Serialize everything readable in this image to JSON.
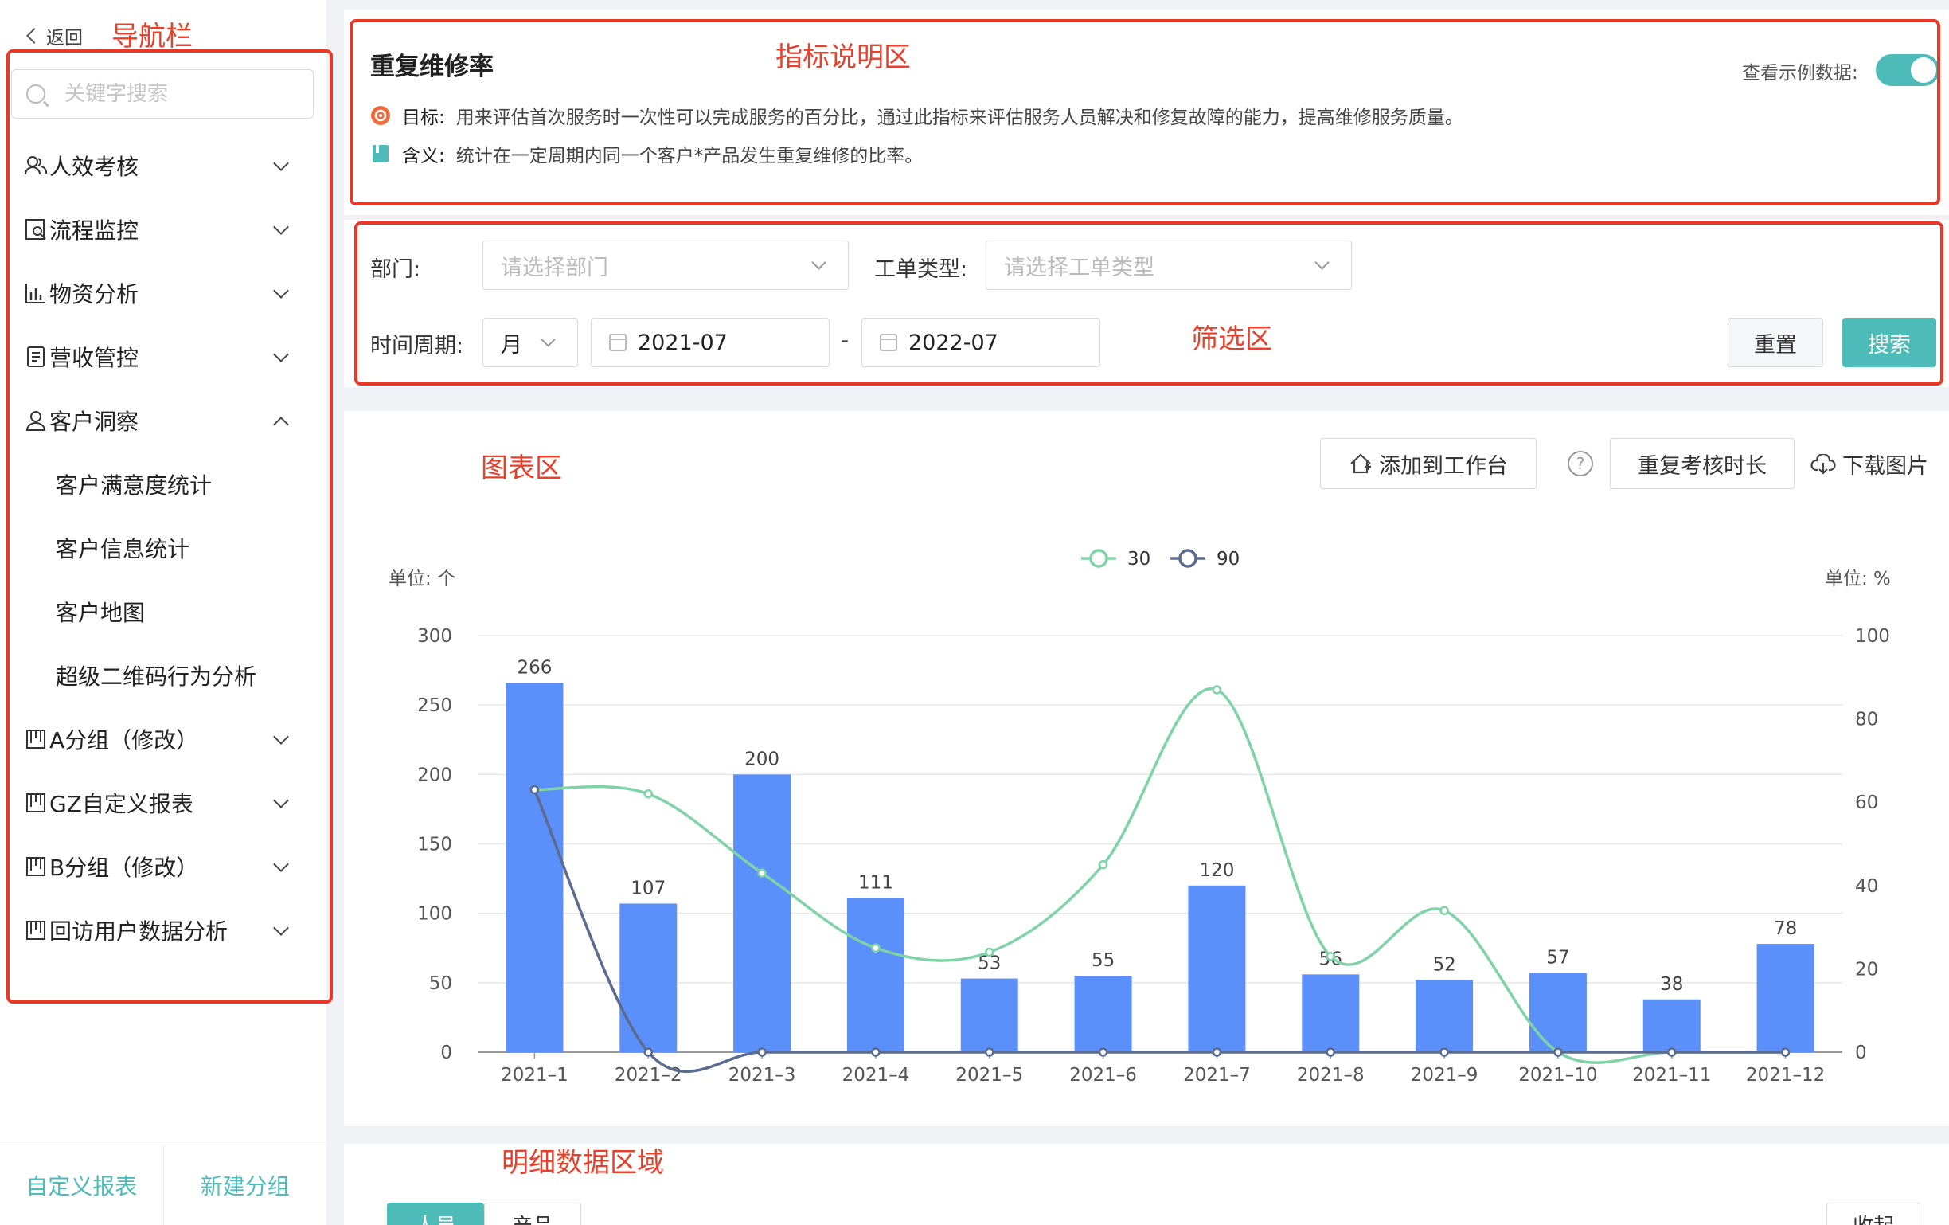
{
  "annotations": {
    "nav": "导航栏",
    "indicator": "指标说明区",
    "filter": "筛选区",
    "chart": "图表区",
    "detail": "明细数据区域"
  },
  "sidebar": {
    "back_label": "返回",
    "search_placeholder": "关键字搜索",
    "items": [
      {
        "label": "人效考核",
        "icon": "people-icon",
        "expanded": false
      },
      {
        "label": "流程监控",
        "icon": "process-icon",
        "expanded": false
      },
      {
        "label": "物资分析",
        "icon": "bar-icon",
        "expanded": false
      },
      {
        "label": "营收管控",
        "icon": "receipt-icon",
        "expanded": false
      },
      {
        "label": "客户洞察",
        "icon": "user-icon",
        "expanded": true,
        "children": [
          "客户满意度统计",
          "客户信息统计",
          "客户地图",
          "超级二维码行为分析"
        ]
      },
      {
        "label": "A分组（修改）",
        "icon": "board-icon",
        "expanded": false
      },
      {
        "label": "GZ自定义报表",
        "icon": "board-icon",
        "expanded": false
      },
      {
        "label": "B分组（修改）",
        "icon": "board-icon",
        "expanded": false
      },
      {
        "label": "回访用户数据分析",
        "icon": "board-icon",
        "expanded": false
      }
    ],
    "bottom": {
      "custom_report": "自定义报表",
      "new_group": "新建分组"
    }
  },
  "indicator": {
    "title": "重复维修率",
    "goal_label": "目标:",
    "goal_text": "用来评估首次服务时一次性可以完成服务的百分比，通过此指标来评估服务人员解决和修复故障的能力，提高维修服务质量。",
    "meaning_label": "含义:",
    "meaning_text": "统计在一定周期内同一个客户*产品发生重复维修的比率。",
    "example_label": "查看示例数据:",
    "example_on": true
  },
  "filter": {
    "dept_label": "部门:",
    "dept_placeholder": "请选择部门",
    "type_label": "工单类型:",
    "type_placeholder": "请选择工单类型",
    "period_label": "时间周期:",
    "period_value": "月",
    "start": "2021-07",
    "end": "2022-07",
    "dash": "-",
    "reset": "重置",
    "search": "搜索"
  },
  "toolbar": {
    "add_to_workbench": "添加到工作台",
    "help": "?",
    "repeat_duration": "重复考核时长",
    "download": "下载图片"
  },
  "chart_data": {
    "type": "bar",
    "categories": [
      "2021–1",
      "2021–2",
      "2021–3",
      "2021–4",
      "2021–5",
      "2021–6",
      "2021–7",
      "2021–8",
      "2021–9",
      "2021–10",
      "2021–11",
      "2021–12"
    ],
    "bar_values": [
      266,
      107,
      200,
      111,
      53,
      55,
      120,
      56,
      52,
      57,
      38,
      78
    ],
    "left_unit": "单位: 个",
    "right_unit": "单位: %",
    "left_ticks": [
      0,
      50,
      100,
      150,
      200,
      250,
      300
    ],
    "right_ticks": [
      0,
      20,
      40,
      60,
      80,
      100
    ],
    "ylim_left": [
      0,
      300
    ],
    "ylim_right": [
      0,
      100
    ],
    "series": [
      {
        "name": "30",
        "color": "#7fd3a6",
        "axis": "right",
        "values": [
          63,
          62,
          43,
          25,
          24,
          45,
          87,
          23,
          34,
          0,
          0,
          0
        ]
      },
      {
        "name": "90",
        "color": "#5b6b8f",
        "axis": "right",
        "values": [
          63,
          0,
          0,
          0,
          0,
          0,
          0,
          0,
          0,
          0,
          0,
          0
        ]
      }
    ],
    "bar_color": "#5b8ff9",
    "legend": "top-center",
    "grid": true
  },
  "detail": {
    "tabs": [
      "人员",
      "产品"
    ],
    "collapse": "收起"
  }
}
